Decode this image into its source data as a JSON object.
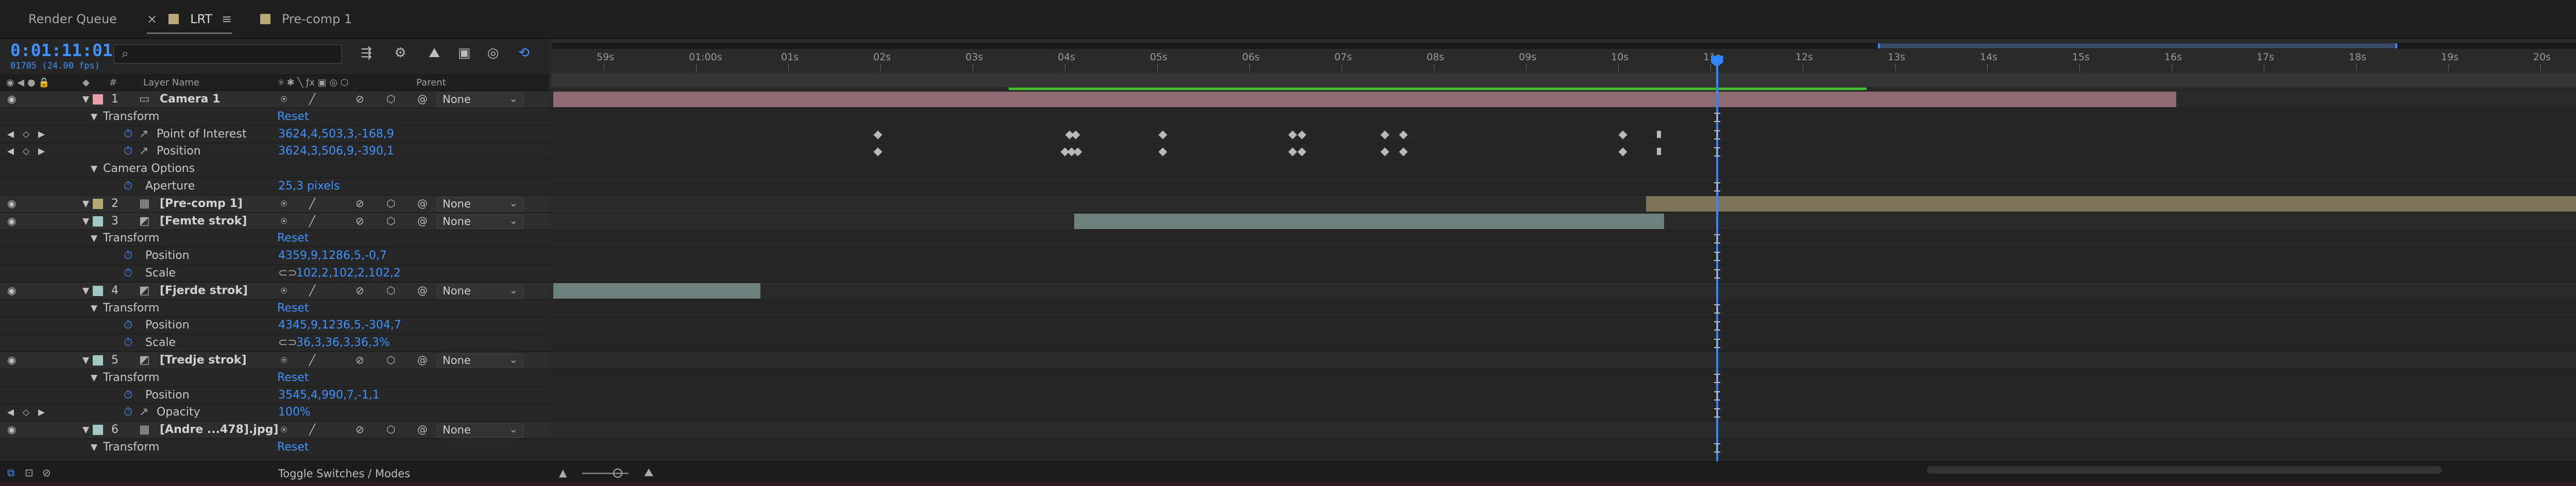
{
  "tabs": [
    {
      "label": "Render Queue",
      "active": false
    },
    {
      "label": "LRT",
      "active": true,
      "close": "×",
      "menu": "≡"
    },
    {
      "label": "Pre-comp 1",
      "active": false
    }
  ],
  "colors": {
    "accent": "#3f93ff",
    "camera_label": "#e8a0aa",
    "precomp_label": "#b8a878",
    "strok_label": "#9fc8c0",
    "camera_bar": "#8e6a72",
    "precomp_bar": "#7d7358",
    "strok_bar": "#6e807c",
    "workarea_green": "#3fbf2f",
    "playhead": "#2f86ff"
  },
  "timecode": "0:01:11:01",
  "fps": "01705 (24.00 fps)",
  "search": {
    "icon": "search-icon",
    "value": ""
  },
  "header": {
    "layer_name": "Layer Name",
    "parent": "Parent",
    "hash": "#"
  },
  "ruler": {
    "ticks": [
      "59s",
      "01:00s",
      "01s",
      "02s",
      "03s",
      "04s",
      "05s",
      "06s",
      "07s",
      "08s",
      "09s",
      "10s",
      "11s",
      "12s",
      "13s",
      "14s",
      "15s",
      "16s",
      "17s",
      "18s",
      "19s",
      "20s"
    ]
  },
  "layers": [
    {
      "kind": "layer",
      "num": "1",
      "name": "Camera 1",
      "label": "#e8a0aa",
      "parent": "None",
      "type_icon": "camera-icon"
    },
    {
      "kind": "group",
      "name": "Transform",
      "value": "Reset",
      "indent": 1
    },
    {
      "kind": "prop",
      "name": "Point of Interest",
      "value": "3624,4,503,3,-168,9",
      "indent": 2,
      "stopwatch": true,
      "graph": true,
      "kfnav": true
    },
    {
      "kind": "prop",
      "name": "Position",
      "value": "3624,3,506,9,-390,1",
      "indent": 2,
      "stopwatch": true,
      "graph": true,
      "kfnav": true
    },
    {
      "kind": "group",
      "name": "Camera Options",
      "value": "",
      "indent": 1
    },
    {
      "kind": "prop",
      "name": "Aperture",
      "value": "25,3 pixels",
      "indent": 2,
      "stopwatch": true
    },
    {
      "kind": "layer",
      "num": "2",
      "name": "[Pre-comp 1]",
      "label": "#b8a878",
      "parent": "None",
      "type_icon": "precomp-icon"
    },
    {
      "kind": "layer",
      "num": "3",
      "name": "[Femte strok]",
      "label": "#9fc8c0",
      "parent": "None",
      "type_icon": "shape-icon"
    },
    {
      "kind": "group",
      "name": "Transform",
      "value": "Reset",
      "indent": 1
    },
    {
      "kind": "prop",
      "name": "Position",
      "value": "4359,9,1286,5,-0,7",
      "indent": 2,
      "stopwatch": true
    },
    {
      "kind": "prop",
      "name": "Scale",
      "value": "102,2,102,2,102,2",
      "indent": 2,
      "stopwatch": true,
      "link": true
    },
    {
      "kind": "layer",
      "num": "4",
      "name": "[Fjerde strok]",
      "label": "#9fc8c0",
      "parent": "None",
      "type_icon": "shape-icon"
    },
    {
      "kind": "group",
      "name": "Transform",
      "value": "Reset",
      "indent": 1
    },
    {
      "kind": "prop",
      "name": "Position",
      "value": "4345,9,1236,5,-304,7",
      "indent": 2,
      "stopwatch": true
    },
    {
      "kind": "prop",
      "name": "Scale",
      "value": "36,3,36,3,36,3%",
      "indent": 2,
      "stopwatch": true,
      "link": true
    },
    {
      "kind": "layer",
      "num": "5",
      "name": "[Tredje strok]",
      "label": "#9fc8c0",
      "parent": "None",
      "type_icon": "shape-icon"
    },
    {
      "kind": "group",
      "name": "Transform",
      "value": "Reset",
      "indent": 1
    },
    {
      "kind": "prop",
      "name": "Position",
      "value": "3545,4,990,7,-1,1",
      "indent": 2,
      "stopwatch": true
    },
    {
      "kind": "prop",
      "name": "Opacity",
      "value": "100%",
      "indent": 2,
      "stopwatch": true,
      "graph": true,
      "kfnav": true
    },
    {
      "kind": "layer",
      "num": "6",
      "name": "[Andre ...478].jpg]",
      "label": "#9fc8c0",
      "parent": "None",
      "type_icon": "footage-icon"
    },
    {
      "kind": "group",
      "name": "Transform",
      "value": "Reset",
      "indent": 1
    }
  ],
  "bars": [
    {
      "row": 0,
      "start_s": -1.55,
      "end_s": 16.05,
      "color": "#8e6a72"
    },
    {
      "row": 6,
      "start_s": 10.3,
      "end_s": 21.0,
      "color": "#7d7358"
    },
    {
      "row": 7,
      "start_s": 4.1,
      "end_s": 10.5,
      "color": "#6e807c"
    },
    {
      "row": 11,
      "start_s": -1.55,
      "end_s": 0.7,
      "color": "#6e807c"
    }
  ],
  "keyframes": [
    {
      "row": 2,
      "times_s": [
        1.97,
        4.05,
        4.12,
        5.06,
        6.47,
        6.57,
        7.47,
        7.67,
        10.05,
        10.45
      ]
    },
    {
      "row": 3,
      "times_s": [
        1.97,
        4.0,
        4.07,
        4.14,
        5.06,
        6.47,
        6.57,
        7.47,
        7.67,
        10.05,
        10.45
      ]
    }
  ],
  "playhead_s": 11.07,
  "bottom": {
    "toggle": "Toggle Switches / Modes"
  }
}
